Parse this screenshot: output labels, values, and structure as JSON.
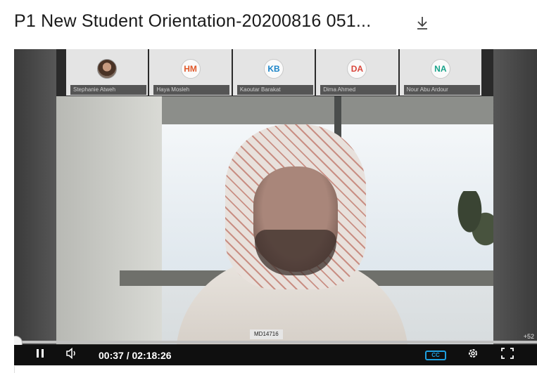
{
  "recording": {
    "title": "P1 New Student Orientation-20200816 051...",
    "download_icon": "download-icon"
  },
  "participants": [
    {
      "name": "Stephanie Atweh",
      "initials": "",
      "color": "#333333",
      "photo": true
    },
    {
      "name": "Haya Mosleh",
      "initials": "HM",
      "color": "#e0582a",
      "photo": false
    },
    {
      "name": "Kaoutar Barakat",
      "initials": "KB",
      "color": "#1b84c8",
      "photo": false
    },
    {
      "name": "Dima Ahmed",
      "initials": "DA",
      "color": "#d9453a",
      "photo": false
    },
    {
      "name": "Nour Abu Ardour",
      "initials": "NA",
      "color": "#18a38a",
      "photo": false
    }
  ],
  "active_speaker": {
    "label": "MD14716"
  },
  "more_participants": "+52",
  "playback": {
    "current_time": "00:37",
    "separator": " / ",
    "duration": "02:18:26",
    "progress_percent": 0.4,
    "cc_label": "CC"
  },
  "icons": {
    "pause": "pause-icon",
    "volume": "volume-icon",
    "captions": "closed-captions-icon",
    "settings": "gear-icon",
    "fullscreen": "fullscreen-icon"
  }
}
